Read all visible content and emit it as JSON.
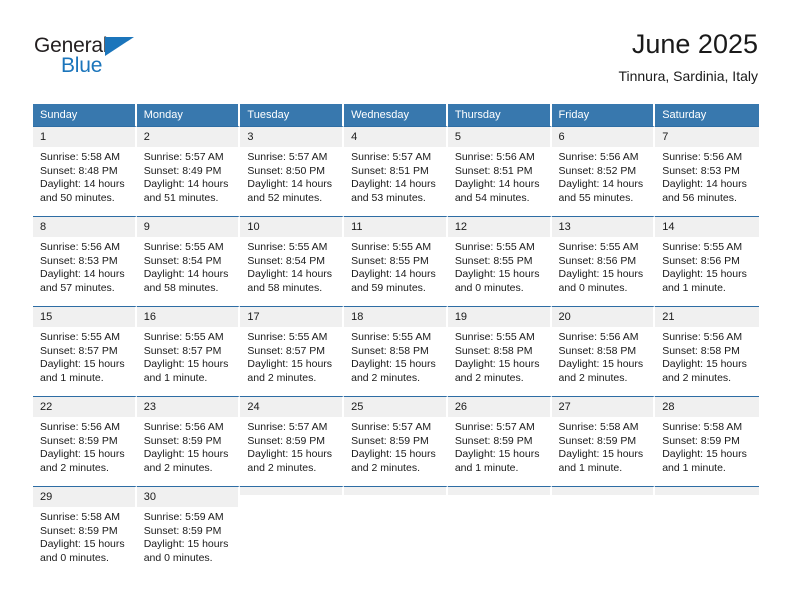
{
  "brand": {
    "name_part1": "General",
    "name_part2": "Blue",
    "accent_color": "#1b75bb"
  },
  "header": {
    "title": "June 2025",
    "subtitle": "Tinnura, Sardinia, Italy"
  },
  "calendar": {
    "header_bg": "#3878ae",
    "row_divider_color": "#2e6da4",
    "daynum_bg": "#f0f0f0",
    "weekday_headers": [
      "Sunday",
      "Monday",
      "Tuesday",
      "Wednesday",
      "Thursday",
      "Friday",
      "Saturday"
    ],
    "weeks": [
      [
        {
          "day": "1",
          "sunrise": "Sunrise: 5:58 AM",
          "sunset": "Sunset: 8:48 PM",
          "daylight": "Daylight: 14 hours and 50 minutes."
        },
        {
          "day": "2",
          "sunrise": "Sunrise: 5:57 AM",
          "sunset": "Sunset: 8:49 PM",
          "daylight": "Daylight: 14 hours and 51 minutes."
        },
        {
          "day": "3",
          "sunrise": "Sunrise: 5:57 AM",
          "sunset": "Sunset: 8:50 PM",
          "daylight": "Daylight: 14 hours and 52 minutes."
        },
        {
          "day": "4",
          "sunrise": "Sunrise: 5:57 AM",
          "sunset": "Sunset: 8:51 PM",
          "daylight": "Daylight: 14 hours and 53 minutes."
        },
        {
          "day": "5",
          "sunrise": "Sunrise: 5:56 AM",
          "sunset": "Sunset: 8:51 PM",
          "daylight": "Daylight: 14 hours and 54 minutes."
        },
        {
          "day": "6",
          "sunrise": "Sunrise: 5:56 AM",
          "sunset": "Sunset: 8:52 PM",
          "daylight": "Daylight: 14 hours and 55 minutes."
        },
        {
          "day": "7",
          "sunrise": "Sunrise: 5:56 AM",
          "sunset": "Sunset: 8:53 PM",
          "daylight": "Daylight: 14 hours and 56 minutes."
        }
      ],
      [
        {
          "day": "8",
          "sunrise": "Sunrise: 5:56 AM",
          "sunset": "Sunset: 8:53 PM",
          "daylight": "Daylight: 14 hours and 57 minutes."
        },
        {
          "day": "9",
          "sunrise": "Sunrise: 5:55 AM",
          "sunset": "Sunset: 8:54 PM",
          "daylight": "Daylight: 14 hours and 58 minutes."
        },
        {
          "day": "10",
          "sunrise": "Sunrise: 5:55 AM",
          "sunset": "Sunset: 8:54 PM",
          "daylight": "Daylight: 14 hours and 58 minutes."
        },
        {
          "day": "11",
          "sunrise": "Sunrise: 5:55 AM",
          "sunset": "Sunset: 8:55 PM",
          "daylight": "Daylight: 14 hours and 59 minutes."
        },
        {
          "day": "12",
          "sunrise": "Sunrise: 5:55 AM",
          "sunset": "Sunset: 8:55 PM",
          "daylight": "Daylight: 15 hours and 0 minutes."
        },
        {
          "day": "13",
          "sunrise": "Sunrise: 5:55 AM",
          "sunset": "Sunset: 8:56 PM",
          "daylight": "Daylight: 15 hours and 0 minutes."
        },
        {
          "day": "14",
          "sunrise": "Sunrise: 5:55 AM",
          "sunset": "Sunset: 8:56 PM",
          "daylight": "Daylight: 15 hours and 1 minute."
        }
      ],
      [
        {
          "day": "15",
          "sunrise": "Sunrise: 5:55 AM",
          "sunset": "Sunset: 8:57 PM",
          "daylight": "Daylight: 15 hours and 1 minute."
        },
        {
          "day": "16",
          "sunrise": "Sunrise: 5:55 AM",
          "sunset": "Sunset: 8:57 PM",
          "daylight": "Daylight: 15 hours and 1 minute."
        },
        {
          "day": "17",
          "sunrise": "Sunrise: 5:55 AM",
          "sunset": "Sunset: 8:57 PM",
          "daylight": "Daylight: 15 hours and 2 minutes."
        },
        {
          "day": "18",
          "sunrise": "Sunrise: 5:55 AM",
          "sunset": "Sunset: 8:58 PM",
          "daylight": "Daylight: 15 hours and 2 minutes."
        },
        {
          "day": "19",
          "sunrise": "Sunrise: 5:55 AM",
          "sunset": "Sunset: 8:58 PM",
          "daylight": "Daylight: 15 hours and 2 minutes."
        },
        {
          "day": "20",
          "sunrise": "Sunrise: 5:56 AM",
          "sunset": "Sunset: 8:58 PM",
          "daylight": "Daylight: 15 hours and 2 minutes."
        },
        {
          "day": "21",
          "sunrise": "Sunrise: 5:56 AM",
          "sunset": "Sunset: 8:58 PM",
          "daylight": "Daylight: 15 hours and 2 minutes."
        }
      ],
      [
        {
          "day": "22",
          "sunrise": "Sunrise: 5:56 AM",
          "sunset": "Sunset: 8:59 PM",
          "daylight": "Daylight: 15 hours and 2 minutes."
        },
        {
          "day": "23",
          "sunrise": "Sunrise: 5:56 AM",
          "sunset": "Sunset: 8:59 PM",
          "daylight": "Daylight: 15 hours and 2 minutes."
        },
        {
          "day": "24",
          "sunrise": "Sunrise: 5:57 AM",
          "sunset": "Sunset: 8:59 PM",
          "daylight": "Daylight: 15 hours and 2 minutes."
        },
        {
          "day": "25",
          "sunrise": "Sunrise: 5:57 AM",
          "sunset": "Sunset: 8:59 PM",
          "daylight": "Daylight: 15 hours and 2 minutes."
        },
        {
          "day": "26",
          "sunrise": "Sunrise: 5:57 AM",
          "sunset": "Sunset: 8:59 PM",
          "daylight": "Daylight: 15 hours and 1 minute."
        },
        {
          "day": "27",
          "sunrise": "Sunrise: 5:58 AM",
          "sunset": "Sunset: 8:59 PM",
          "daylight": "Daylight: 15 hours and 1 minute."
        },
        {
          "day": "28",
          "sunrise": "Sunrise: 5:58 AM",
          "sunset": "Sunset: 8:59 PM",
          "daylight": "Daylight: 15 hours and 1 minute."
        }
      ],
      [
        {
          "day": "29",
          "sunrise": "Sunrise: 5:58 AM",
          "sunset": "Sunset: 8:59 PM",
          "daylight": "Daylight: 15 hours and 0 minutes."
        },
        {
          "day": "30",
          "sunrise": "Sunrise: 5:59 AM",
          "sunset": "Sunset: 8:59 PM",
          "daylight": "Daylight: 15 hours and 0 minutes."
        },
        {
          "day": "",
          "sunrise": "",
          "sunset": "",
          "daylight": ""
        },
        {
          "day": "",
          "sunrise": "",
          "sunset": "",
          "daylight": ""
        },
        {
          "day": "",
          "sunrise": "",
          "sunset": "",
          "daylight": ""
        },
        {
          "day": "",
          "sunrise": "",
          "sunset": "",
          "daylight": ""
        },
        {
          "day": "",
          "sunrise": "",
          "sunset": "",
          "daylight": ""
        }
      ]
    ]
  }
}
